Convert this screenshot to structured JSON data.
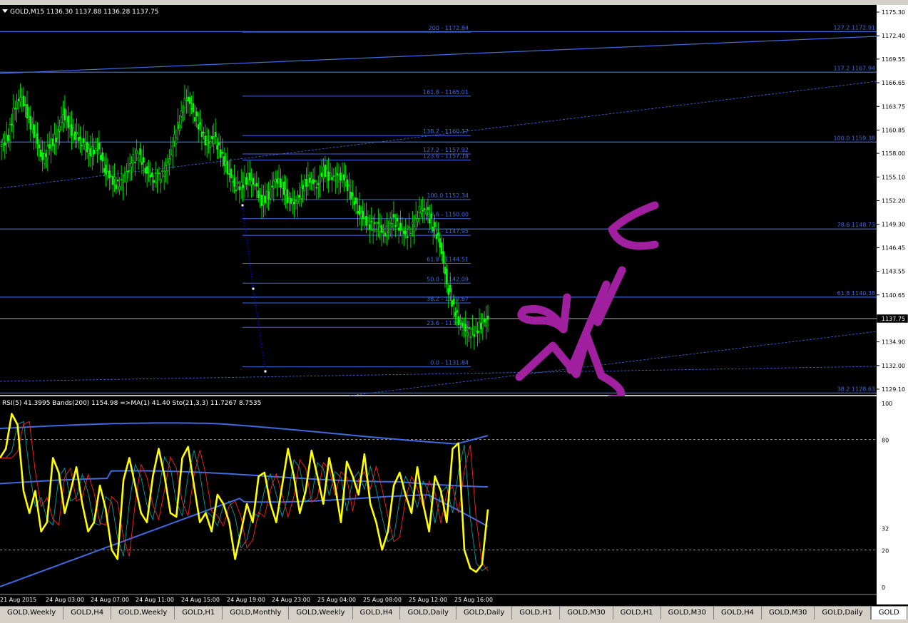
{
  "window": {
    "symbol_header": "GOLD,M15  1136.30 1137.88 1136.28 1137.75",
    "indicator_header": "RSI(5) 41.3995  Bands(200) 1154.98  =>MA(1) 41.40  Sto(21,3,3) 11.7267 8.7535"
  },
  "colors": {
    "background": "#000000",
    "candles": "#00ff00",
    "levels": "#4169e1",
    "rsi": "#ffff00",
    "annotation": "#a020a0"
  },
  "chart_data": {
    "type": "candlestick",
    "symbol": "GOLD",
    "timeframe": "M15",
    "price_axis": {
      "ylim": [
        1128.5,
        1176.5
      ],
      "ticks": [
        "1175.30",
        "1172.40",
        "1169.55",
        "1166.65",
        "1163.75",
        "1160.85",
        "1158.00",
        "1155.10",
        "1152.20",
        "1149.30",
        "1146.45",
        "1143.55",
        "1140.65",
        "1137.75",
        "1134.90",
        "1132.00",
        "1129.10"
      ],
      "current_price": "1137.75"
    },
    "time_axis": [
      "21 Aug 2015",
      "24 Aug 03:00",
      "24 Aug 07:00",
      "24 Aug 11:00",
      "24 Aug 15:00",
      "24 Aug 19:00",
      "24 Aug 23:00",
      "25 Aug 04:00",
      "25 Aug 08:00",
      "25 Aug 12:00",
      "25 Aug 16:00"
    ],
    "close_path": [
      1159,
      1160,
      1164,
      1165,
      1162,
      1160,
      1157,
      1159,
      1160,
      1163,
      1161,
      1160,
      1159,
      1158,
      1159,
      1156,
      1155,
      1154,
      1155,
      1157,
      1158,
      1156,
      1155,
      1155,
      1156,
      1159,
      1162,
      1165,
      1163,
      1161,
      1159,
      1160,
      1158,
      1156,
      1154,
      1154,
      1155,
      1154,
      1152,
      1153,
      1155,
      1154,
      1152,
      1152,
      1154,
      1155,
      1154,
      1156,
      1155,
      1155,
      1155,
      1153,
      1151,
      1150,
      1149,
      1149,
      1148,
      1150,
      1149,
      1148,
      1149,
      1151,
      1151,
      1149,
      1147,
      1142,
      1139,
      1137,
      1136,
      1136,
      1137,
      1137.75
    ],
    "fib_retracement_labels": [
      "200 - 1172.84",
      "161.8 - 1165.01",
      "138.2 - 1160.17",
      "127.2 - 1157.92",
      "123.6 - 1157.18",
      "100.0 1152.34",
      "88.6 - 1150.00",
      "78.6 - 1147.95",
      "61.8 - 1144.51",
      "50.0 - 1142.09",
      "38.2 - 1139.67",
      "23.6 - 1136.68",
      "0.0 - 1131.84"
    ],
    "fib_extension_labels": [
      "127.2 1172.91",
      "117.2 1167.94",
      "100.0 1159.38",
      "78.6 1148.73",
      "61.8 1140.38",
      "38.2 1128.63"
    ],
    "indicator": {
      "levels": [
        "100",
        "80",
        "32",
        "20",
        "0"
      ],
      "rsi_path": [
        70,
        75,
        94,
        88,
        52,
        40,
        52,
        30,
        35,
        70,
        62,
        40,
        52,
        65,
        45,
        30,
        35,
        55,
        42,
        20,
        15,
        58,
        70,
        55,
        40,
        35,
        60,
        75,
        60,
        40,
        38,
        70,
        76,
        55,
        35,
        40,
        30,
        50,
        45,
        35,
        15,
        30,
        45,
        35,
        60,
        62,
        45,
        35,
        55,
        75,
        60,
        40,
        52,
        74,
        60,
        45,
        70,
        55,
        35,
        68,
        60,
        50,
        72,
        45,
        35,
        20,
        30,
        55,
        62,
        50,
        40,
        65,
        45,
        30,
        60,
        52,
        35,
        75,
        78,
        20,
        10,
        8,
        12,
        42
      ]
    }
  },
  "tabs": [
    "GOLD,Weekly",
    "GOLD,H4",
    "GOLD,Weekly",
    "GOLD,H1",
    "GOLD,Monthly",
    "GOLD,Weekly",
    "GOLD,H4",
    "GOLD,Daily",
    "GOLD,Daily",
    "GOLD,H1",
    "GOLD,M30",
    "GOLD,H1",
    "GOLD,M30",
    "GOLD,H4",
    "GOLD,M30",
    "GOLD,Daily",
    "GOLD"
  ]
}
